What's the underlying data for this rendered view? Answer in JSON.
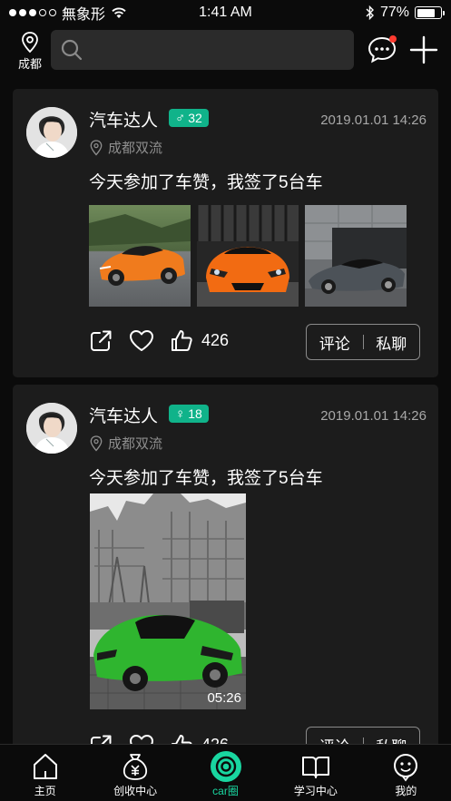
{
  "status_bar": {
    "carrier": "無象形",
    "time": "1:41 AM",
    "battery_text": "77%",
    "battery_level": 0.77,
    "signal_dots_filled": 3,
    "signal_dots_total": 5
  },
  "header": {
    "location_label": "成都",
    "search_placeholder": "",
    "message_icon": "message-bubble-icon",
    "add_icon": "plus-icon",
    "has_unread": true
  },
  "posts": [
    {
      "username": "汽车达人",
      "gender_symbol": "♂",
      "age": "32",
      "datetime": "2019.01.01 14:26",
      "location": "成都双流",
      "text": "今天参加了车赞，我签了5台车",
      "media": [
        "orange-sports-car-photo",
        "orange-supercar-front-photo",
        "grey-concept-car-photo"
      ],
      "like_count": "426",
      "comment_label": "评论",
      "chat_label": "私聊"
    },
    {
      "username": "汽车达人",
      "gender_symbol": "♀",
      "age": "18",
      "datetime": "2019.01.01 14:26",
      "location": "成都双流",
      "text": "今天参加了车赞，我签了5台车",
      "video_duration": "05:26",
      "like_count": "426",
      "comment_label": "评论",
      "chat_label": "私聊"
    }
  ],
  "tabs": [
    {
      "label": "主页",
      "icon": "home-icon",
      "active": false
    },
    {
      "label": "创收中心",
      "icon": "money-bag-icon",
      "active": false
    },
    {
      "label": "car圈",
      "icon": "car-circle-icon",
      "active": true
    },
    {
      "label": "学习中心",
      "icon": "book-icon",
      "active": false
    },
    {
      "label": "我的",
      "icon": "profile-icon",
      "active": false
    }
  ],
  "colors": {
    "accent": "#19d6a0",
    "gender_badge": "#10b38a",
    "card_bg": "#1c1c1c",
    "badge_red": "#ff3b30"
  }
}
